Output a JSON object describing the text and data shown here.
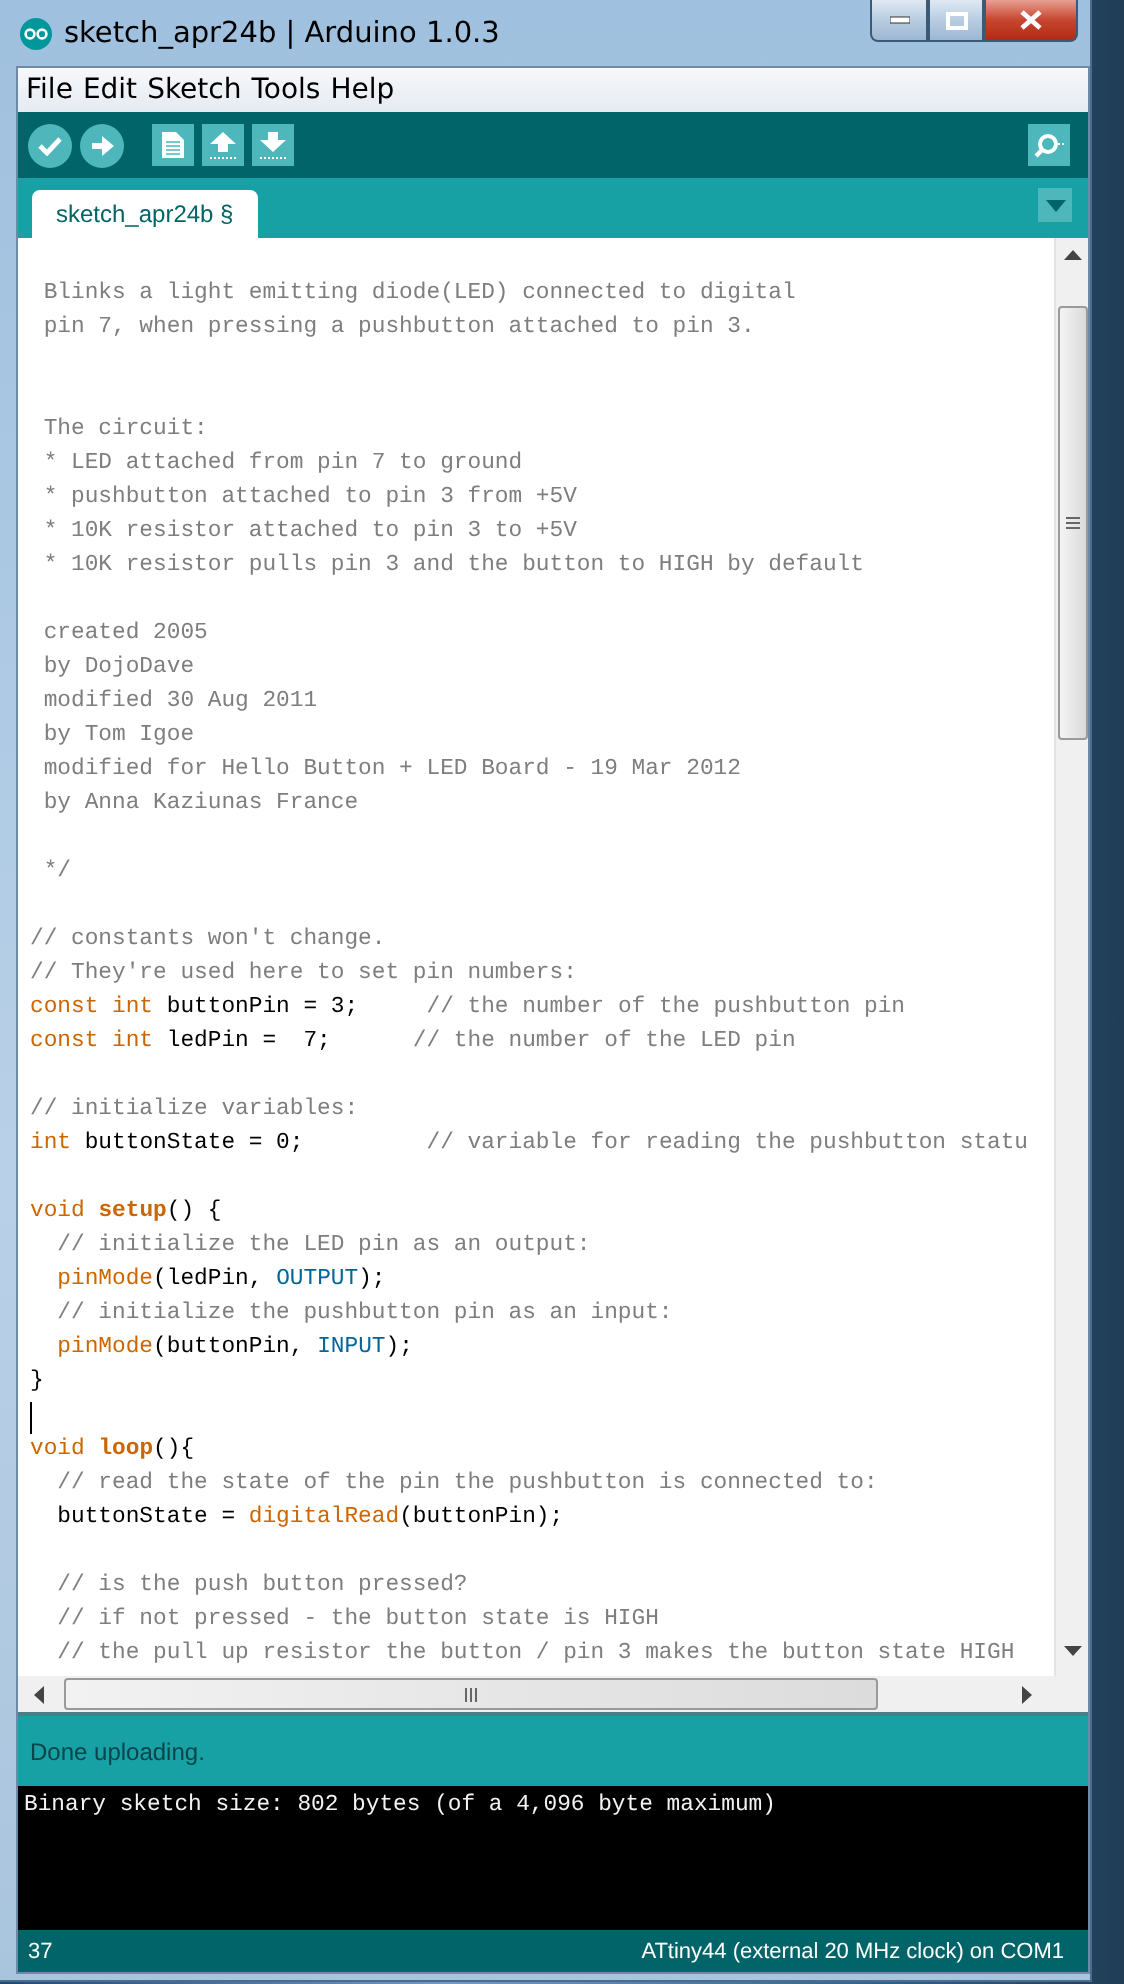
{
  "window": {
    "title": "sketch_apr24b | Arduino 1.0.3"
  },
  "menu": [
    "File",
    "Edit",
    "Sketch",
    "Tools",
    "Help"
  ],
  "toolbar": [
    {
      "kind": "verify"
    },
    {
      "kind": "upload"
    },
    {
      "kind": "new"
    },
    {
      "kind": "open"
    },
    {
      "kind": "save"
    }
  ],
  "tabs": [
    {
      "label": "sketch_apr24b §",
      "selected": true
    }
  ],
  "code": [
    {
      "kind": "code",
      "tokens": [
        {
          "kind": "comment",
          "text": " Blinks a light emitting diode(LED) connected to digital"
        }
      ]
    },
    {
      "kind": "code",
      "tokens": [
        {
          "kind": "comment",
          "text": " pin 7, when pressing a pushbutton attached to pin 3."
        }
      ]
    },
    {
      "kind": "blank"
    },
    {
      "kind": "blank"
    },
    {
      "kind": "code",
      "tokens": [
        {
          "kind": "comment",
          "text": " The circuit:"
        }
      ]
    },
    {
      "kind": "code",
      "tokens": [
        {
          "kind": "comment",
          "text": " * LED attached from pin 7 to ground"
        }
      ]
    },
    {
      "kind": "code",
      "tokens": [
        {
          "kind": "comment",
          "text": " * pushbutton attached to pin 3 from +5V"
        }
      ]
    },
    {
      "kind": "code",
      "tokens": [
        {
          "kind": "comment",
          "text": " * 10K resistor attached to pin 3 to +5V"
        }
      ]
    },
    {
      "kind": "code",
      "tokens": [
        {
          "kind": "comment",
          "text": " * 10K resistor pulls pin 3 and the button to HIGH by default"
        }
      ]
    },
    {
      "kind": "blank"
    },
    {
      "kind": "code",
      "tokens": [
        {
          "kind": "comment",
          "text": " created 2005"
        }
      ]
    },
    {
      "kind": "code",
      "tokens": [
        {
          "kind": "comment",
          "text": " by DojoDave"
        }
      ]
    },
    {
      "kind": "code",
      "tokens": [
        {
          "kind": "comment",
          "text": " modified 30 Aug 2011"
        }
      ]
    },
    {
      "kind": "code",
      "tokens": [
        {
          "kind": "comment",
          "text": " by Tom Igoe"
        }
      ]
    },
    {
      "kind": "code",
      "tokens": [
        {
          "kind": "comment",
          "text": " modified for Hello Button + LED Board - 19 Mar 2012"
        }
      ]
    },
    {
      "kind": "code",
      "tokens": [
        {
          "kind": "comment",
          "text": " by Anna Kaziunas France"
        }
      ]
    },
    {
      "kind": "blank"
    },
    {
      "kind": "code",
      "tokens": [
        {
          "kind": "comment",
          "text": " */"
        }
      ]
    },
    {
      "kind": "blank"
    },
    {
      "kind": "code",
      "tokens": [
        {
          "kind": "comment",
          "text": "// constants won't change."
        }
      ]
    },
    {
      "kind": "code",
      "tokens": [
        {
          "kind": "comment",
          "text": "// They're used here to set pin numbers:"
        }
      ]
    },
    {
      "kind": "code",
      "tokens": [
        {
          "kind": "keyword",
          "text": "const int"
        },
        {
          "kind": "plain",
          "text": " buttonPin = 3;     "
        },
        {
          "kind": "comment",
          "text": "// the number of the pushbutton pin"
        }
      ]
    },
    {
      "kind": "code",
      "tokens": [
        {
          "kind": "keyword",
          "text": "const int"
        },
        {
          "kind": "plain",
          "text": " ledPin =  7;      "
        },
        {
          "kind": "comment",
          "text": "// the number of the LED pin"
        }
      ]
    },
    {
      "kind": "blank"
    },
    {
      "kind": "code",
      "tokens": [
        {
          "kind": "comment",
          "text": "// initialize variables:"
        }
      ]
    },
    {
      "kind": "code",
      "tokens": [
        {
          "kind": "keyword",
          "text": "int"
        },
        {
          "kind": "plain",
          "text": " buttonState = 0;         "
        },
        {
          "kind": "comment",
          "text": "// variable for reading the pushbutton statu"
        }
      ]
    },
    {
      "kind": "blank"
    },
    {
      "kind": "code",
      "tokens": [
        {
          "kind": "keyword",
          "text": "void "
        },
        {
          "kind": "function-bold",
          "text": "setup"
        },
        {
          "kind": "plain",
          "text": "() {"
        }
      ]
    },
    {
      "kind": "code",
      "tokens": [
        {
          "kind": "comment",
          "text": "  // initialize the LED pin as an output:"
        }
      ]
    },
    {
      "kind": "code",
      "tokens": [
        {
          "kind": "function",
          "text": "  pinMode"
        },
        {
          "kind": "plain",
          "text": "(ledPin, "
        },
        {
          "kind": "constant",
          "text": "OUTPUT"
        },
        {
          "kind": "plain",
          "text": ");"
        }
      ]
    },
    {
      "kind": "code",
      "tokens": [
        {
          "kind": "comment",
          "text": "  // initialize the pushbutton pin as an input:"
        }
      ]
    },
    {
      "kind": "code",
      "tokens": [
        {
          "kind": "function",
          "text": "  pinMode"
        },
        {
          "kind": "plain",
          "text": "(buttonPin, "
        },
        {
          "kind": "constant",
          "text": "INPUT"
        },
        {
          "kind": "plain",
          "text": ");"
        }
      ]
    },
    {
      "kind": "code",
      "tokens": [
        {
          "kind": "plain",
          "text": "}"
        }
      ]
    },
    {
      "kind": "cursor"
    },
    {
      "kind": "code",
      "tokens": [
        {
          "kind": "keyword",
          "text": "void "
        },
        {
          "kind": "function-bold",
          "text": "loop"
        },
        {
          "kind": "plain",
          "text": "(){"
        }
      ]
    },
    {
      "kind": "code",
      "tokens": [
        {
          "kind": "comment",
          "text": "  // read the state of the pin the pushbutton is connected to:"
        }
      ]
    },
    {
      "kind": "code",
      "tokens": [
        {
          "kind": "plain",
          "text": "  buttonState = "
        },
        {
          "kind": "function",
          "text": "digitalRead"
        },
        {
          "kind": "plain",
          "text": "(buttonPin);"
        }
      ]
    },
    {
      "kind": "blank"
    },
    {
      "kind": "code",
      "tokens": [
        {
          "kind": "comment",
          "text": "  // is the push button pressed?"
        }
      ]
    },
    {
      "kind": "code",
      "tokens": [
        {
          "kind": "comment",
          "text": "  // if not pressed - the button state is HIGH"
        }
      ]
    },
    {
      "kind": "code",
      "tokens": [
        {
          "kind": "comment",
          "text": "  // the pull up resistor the button / pin 3 makes the button state HIGH"
        }
      ]
    }
  ],
  "message": "Done uploading.",
  "console": [
    "Binary sketch size: 802 bytes (of a 4,096 byte maximum)"
  ],
  "status_bar": {
    "line": "37",
    "board": "ATtiny44 (external 20 MHz clock) on COM1"
  }
}
